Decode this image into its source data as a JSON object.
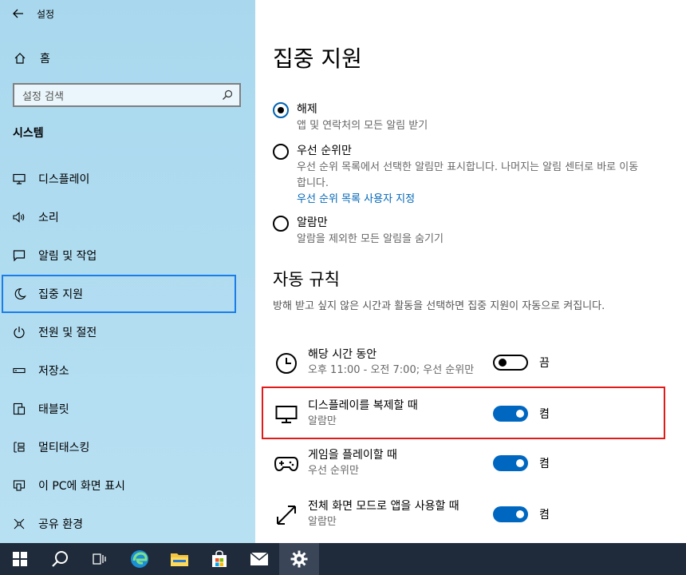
{
  "window": {
    "title": "설정"
  },
  "sidebar": {
    "home_label": "홈",
    "search_placeholder": "설정 검색",
    "section_title": "시스템",
    "items": [
      {
        "label": "디스플레이",
        "icon": "monitor-icon"
      },
      {
        "label": "소리",
        "icon": "speaker-icon"
      },
      {
        "label": "알림 및 작업",
        "icon": "notification-icon"
      },
      {
        "label": "집중 지원",
        "icon": "moon-icon",
        "active": true
      },
      {
        "label": "전원 및 절전",
        "icon": "power-icon"
      },
      {
        "label": "저장소",
        "icon": "storage-icon"
      },
      {
        "label": "태블릿",
        "icon": "tablet-icon"
      },
      {
        "label": "멀티태스킹",
        "icon": "multitasking-icon"
      },
      {
        "label": "이 PC에 화면 표시",
        "icon": "project-icon"
      },
      {
        "label": "공유 환경",
        "icon": "share-icon"
      }
    ]
  },
  "main": {
    "title": "집중 지원",
    "options": [
      {
        "label": "해제",
        "desc": "앱 및 연락처의 모든 알림 받기",
        "checked": true
      },
      {
        "label": "우선 순위만",
        "desc": "우선 순위 목록에서 선택한 알림만 표시합니다. 나머지는 알림 센터로 바로 이동합니다.",
        "link": "우선 순위 목록 사용자 지정",
        "checked": false
      },
      {
        "label": "알람만",
        "desc": "알람을 제외한 모든 알림을 숨기기",
        "checked": false
      }
    ],
    "auto_rules": {
      "heading": "자동 규칙",
      "desc": "방해 받고 싶지 않은 시간과 활동을 선택하면 집중 지원이 자동으로 켜집니다.",
      "rules": [
        {
          "label": "해당 시간 동안",
          "sub": "오후 11:00 - 오전 7:00; 우선 순위만",
          "state": "끔",
          "on": false,
          "icon": "clock-icon"
        },
        {
          "label": "디스플레이를 복제할 때",
          "sub": "알람만",
          "state": "켬",
          "on": true,
          "icon": "monitor-icon"
        },
        {
          "label": "게임을 플레이할 때",
          "sub": "우선 순위만",
          "state": "켬",
          "on": true,
          "icon": "gamepad-icon"
        },
        {
          "label": "전체 화면 모드로 앱을 사용할 때",
          "sub": "알람만",
          "state": "켬",
          "on": true,
          "icon": "fullscreen-icon"
        }
      ]
    }
  },
  "taskbar": {
    "items": [
      "windows-start-icon",
      "search-icon",
      "task-view-icon",
      "edge-icon",
      "file-explorer-icon",
      "store-icon",
      "mail-icon",
      "settings-icon"
    ]
  },
  "colors": {
    "accent": "#0067c0",
    "highlight": "#e21a1a",
    "sidebar_bg": "#b3ddf1",
    "taskbar_bg": "#1f2b3a"
  }
}
